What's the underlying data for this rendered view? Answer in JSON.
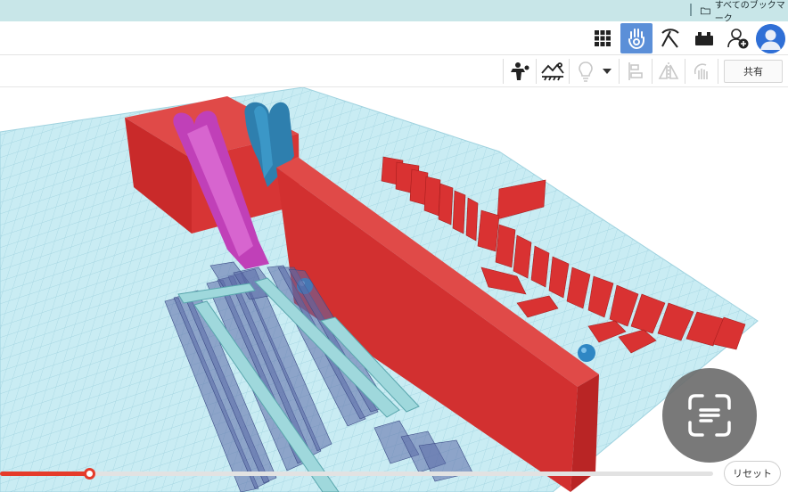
{
  "bookmarks": {
    "folder_label": "すべてのブックマーク",
    "folder_icon": "folder-icon"
  },
  "app_bar": {
    "buttons": [
      {
        "name": "grid-view-button",
        "icon": "grid-icon"
      },
      {
        "name": "tinker-hand-button",
        "icon": "hand-icon",
        "active": true
      },
      {
        "name": "pickaxe-button",
        "icon": "pickaxe-icon"
      },
      {
        "name": "bricks-button",
        "icon": "brick-icon"
      },
      {
        "name": "add-user-button",
        "icon": "add-user-icon"
      }
    ],
    "avatar_icon": "user-avatar-icon"
  },
  "toolbar": {
    "share_label": "共有",
    "reset_label": "リセット",
    "buttons": [
      "simulate-icon",
      "physics-scene-icon",
      "light-bulb-icon",
      "dropdown-arrow-icon",
      "align-icon",
      "mirror-icon",
      "cruise-icon"
    ]
  },
  "timeline": {
    "progress": 0.125
  },
  "colors": {
    "accent": "#5b8fd8",
    "timeline": "#e53b2a",
    "grid_bg": "#c9ecf3",
    "grid_line": "#9fd2df",
    "red_block": "#d93232",
    "magenta_slide": "#c040b8",
    "blue_slide": "#2e7fae"
  },
  "lens_icon": "google-lens-icon"
}
